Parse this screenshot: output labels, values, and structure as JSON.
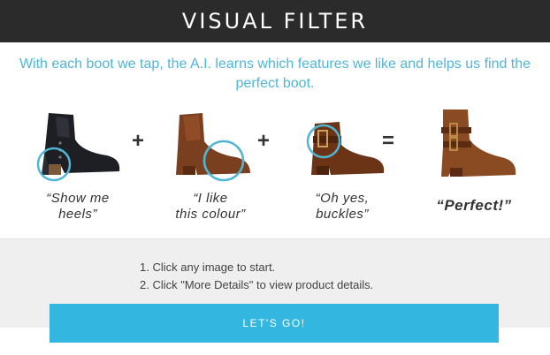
{
  "header": {
    "title": "VISUAL FILTER"
  },
  "intro": {
    "text": "With each boot we tap, the A.I. learns which features we like and helps us find the perfect boot."
  },
  "boots": [
    {
      "caption_line1": "“Show me",
      "caption_line2": "heels”",
      "highlight": "heel",
      "color": "#1d1f24"
    },
    {
      "caption_line1": "“I like",
      "caption_line2": "this colour”",
      "highlight": "colour",
      "color": "#7a3f1f"
    },
    {
      "caption_line1": "“Oh yes,",
      "caption_line2": "buckles”",
      "highlight": "buckle",
      "color": "#6b3417"
    },
    {
      "caption_line1": "“Perfect!”",
      "caption_line2": "",
      "highlight": "none",
      "color": "#8a4a22"
    }
  ],
  "operators": [
    "+",
    "+",
    "="
  ],
  "instructions": {
    "steps": [
      "1.  Click any image to start.",
      "2.  Click \"More Details\" to view product details."
    ]
  },
  "cta": {
    "label": "LET'S GO!"
  },
  "colors": {
    "accent": "#33b7e0",
    "intro_text": "#4fb6d6",
    "header_bg": "#2b2b2b",
    "panel_bg": "#efefef"
  }
}
